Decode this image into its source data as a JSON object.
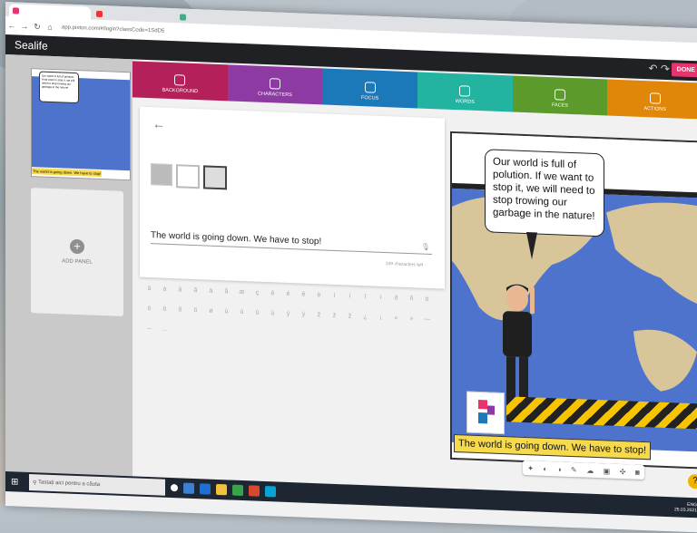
{
  "browser": {
    "url": "app.pixton.com/#/login?classCode=1SdD5",
    "tabs": [
      "",
      "",
      ""
    ]
  },
  "app": {
    "title": "Sealife",
    "done_label": "DONE"
  },
  "sidebar": {
    "thumbnail": {
      "bubble": "Our world is full of polution. If we want to stop it, we will need to stop trowing our garbage in the nature!",
      "caption": "The world is going down. We have to stop!"
    },
    "add_panel_label": "ADD PANEL"
  },
  "categories": [
    {
      "label": "BACKGROUND",
      "color": "#b4205a",
      "icon": "image-icon"
    },
    {
      "label": "CHARACTERS",
      "color": "#8e3aa3",
      "icon": "face-icon"
    },
    {
      "label": "FOCUS",
      "color": "#1b78b9",
      "icon": "move-icon"
    },
    {
      "label": "WORDS",
      "color": "#22b4a0",
      "icon": "speech-icon"
    },
    {
      "label": "FACES",
      "color": "#5c9a2b",
      "icon": "smile-icon"
    },
    {
      "label": "ACTIONS",
      "color": "#e0870a",
      "icon": "run-icon"
    }
  ],
  "editor": {
    "text_value": "The world is going down. We have to stop!",
    "counter": "249 characters left",
    "special_chars": [
      "à",
      "á",
      "â",
      "ã",
      "ä",
      "å",
      "æ",
      "ç",
      "è",
      "é",
      "ê",
      "ë",
      "ì",
      "í",
      "î",
      "ï",
      "ð",
      "ñ",
      "ò",
      "ó",
      "ô",
      "õ",
      "ö",
      "ø",
      "ù",
      "ú",
      "û",
      "ü",
      "ý",
      "ÿ",
      "ž",
      "ž",
      "ž",
      "¿",
      "¡",
      "«",
      "»",
      "—",
      "–",
      "…"
    ]
  },
  "panel": {
    "bubble": "Our world is full of polution. If we want to stop it, we will need to stop trowing our garbage in the nature!",
    "caption": "The world is going down. We have to stop!"
  },
  "taskbar": {
    "search_placeholder": "Tastați aici pentru a căuta",
    "lang": "ENG",
    "date": "25.03.2021"
  },
  "colors": {
    "done": "#e8336d",
    "map_water": "#4d73cc",
    "caption_bg": "#f7d94c"
  }
}
